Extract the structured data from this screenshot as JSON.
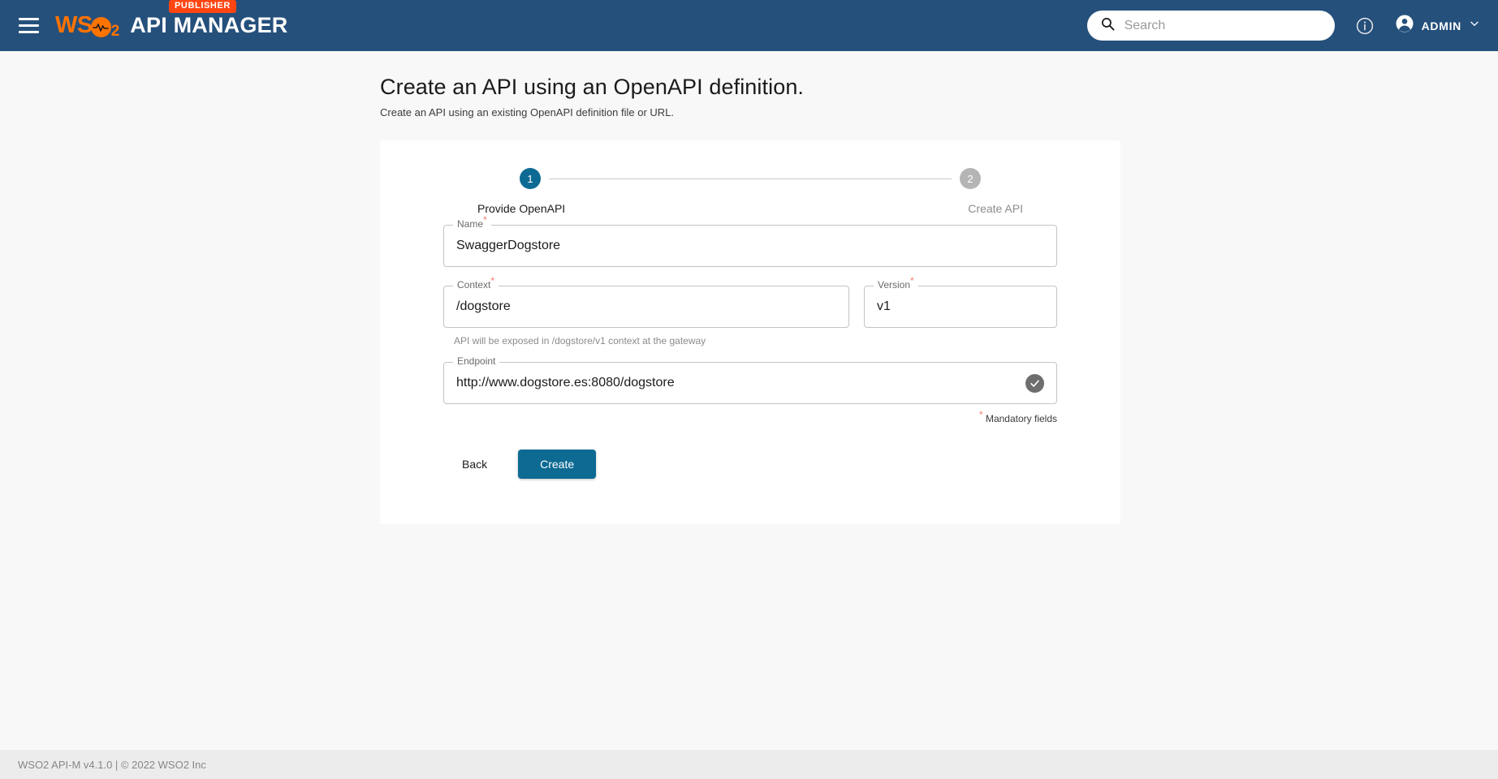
{
  "header": {
    "menu_icon": "hamburger-menu-icon",
    "brand": {
      "ws": "WS",
      "subscript": "2",
      "product": "API MANAGER",
      "badge": "PUBLISHER"
    },
    "search": {
      "placeholder": "Search",
      "value": "",
      "icon": "search-icon"
    },
    "help_icon": "info-circle-icon",
    "user": {
      "avatar_icon": "account-circle-icon",
      "name": "ADMIN",
      "chevron_icon": "chevron-down-icon"
    }
  },
  "page": {
    "title": "Create an API using an OpenAPI definition.",
    "subtitle": "Create an API using an existing OpenAPI definition file or URL."
  },
  "stepper": {
    "steps": [
      {
        "number": "1",
        "label": "Provide OpenAPI",
        "state": "active"
      },
      {
        "number": "2",
        "label": "Create API",
        "state": "inactive"
      }
    ]
  },
  "form": {
    "name": {
      "label": "Name",
      "required": true,
      "value": "SwaggerDogstore",
      "placeholder": ""
    },
    "context": {
      "label": "Context",
      "required": true,
      "value": "/dogstore",
      "placeholder": "",
      "helper": "API will be exposed in /dogstore/v1 context at the gateway"
    },
    "version": {
      "label": "Version",
      "required": true,
      "value": "v1",
      "placeholder": ""
    },
    "endpoint": {
      "label": "Endpoint",
      "required": false,
      "value": "http://www.dogstore.es:8080/dogstore",
      "placeholder": "",
      "status_icon": "check-circle-icon"
    },
    "mandatory_note": "Mandatory fields",
    "mandatory_star": "*",
    "buttons": {
      "back": "Back",
      "create": "Create"
    }
  },
  "footer": {
    "text": "WSO2 API-M v4.1.0 | © 2022 WSO2 Inc"
  },
  "colors": {
    "appbar": "#25507b",
    "brand_orange": "#ff7300",
    "badge": "#ff4612",
    "primary": "#0d6a93",
    "required_star": "#f4786d",
    "page_bg": "#f8f8f8",
    "footer_bg": "#ececec"
  }
}
